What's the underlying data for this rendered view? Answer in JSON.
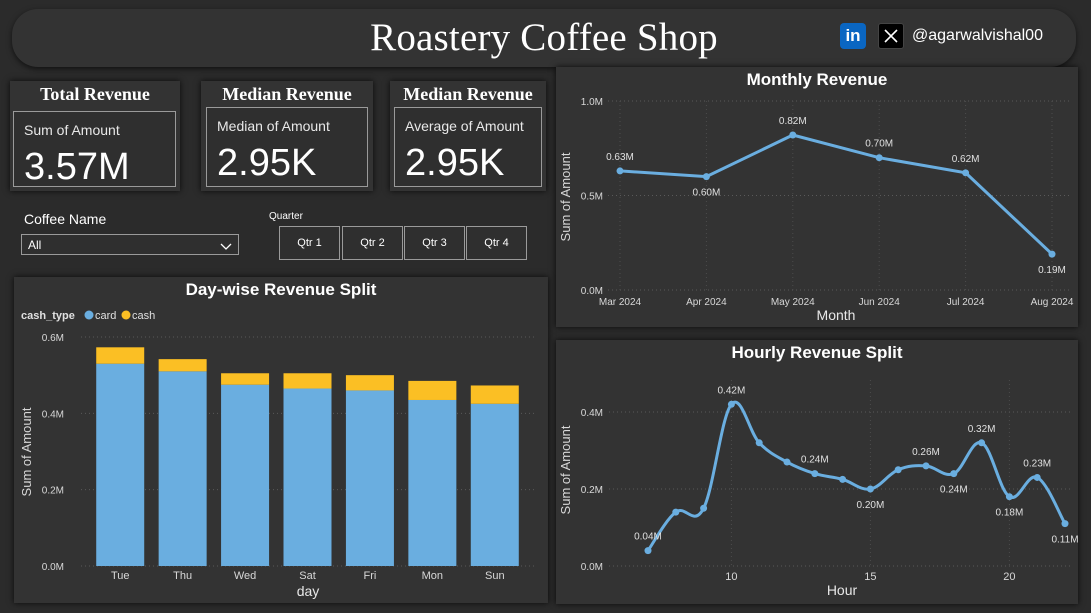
{
  "header": {
    "title": "Roastery Coffee Shop",
    "linkedin_icon_text": "in",
    "handle": "@agarwalvishal00"
  },
  "kpis": [
    {
      "title": "Total Revenue",
      "label": "Sum of Amount",
      "value": "3.57M"
    },
    {
      "title": "Median Revenue",
      "label": "Median of Amount",
      "value": "2.95K"
    },
    {
      "title": "Median Revenue",
      "label": "Average of Amount",
      "value": "2.95K"
    }
  ],
  "filters": {
    "coffee_name_label": "Coffee Name",
    "coffee_name_value": "All",
    "quarter_label": "Quarter",
    "quarters": [
      "Qtr 1",
      "Qtr 2",
      "Qtr 3",
      "Qtr 4"
    ]
  },
  "colors": {
    "card": "#6aaee0",
    "cash": "#fbbf24",
    "line": "#6aaee0",
    "background": "#2b2b2b",
    "panel": "#333333"
  },
  "chart_data": [
    {
      "type": "bar",
      "stacked": true,
      "title": "Day-wise Revenue Split",
      "legend_title": "cash_type",
      "legend_position": "top-left",
      "xlabel": "day",
      "ylabel": "Sum of Amount",
      "categories": [
        "Tue",
        "Thu",
        "Wed",
        "Sat",
        "Fri",
        "Mon",
        "Sun"
      ],
      "series": [
        {
          "name": "card",
          "values": [
            0.53,
            0.51,
            0.475,
            0.465,
            0.46,
            0.435,
            0.425
          ]
        },
        {
          "name": "cash",
          "values": [
            0.043,
            0.032,
            0.03,
            0.04,
            0.04,
            0.05,
            0.048
          ]
        }
      ],
      "ylim": [
        0,
        0.6
      ],
      "yticks": [
        "0.0M",
        "0.2M",
        "0.4M",
        "0.6M"
      ],
      "grid": true
    },
    {
      "type": "line",
      "title": "Monthly Revenue",
      "xlabel": "Month",
      "ylabel": "Sum of Amount",
      "categories": [
        "Mar 2024",
        "Apr 2024",
        "May 2024",
        "Jun 2024",
        "Jul 2024",
        "Aug 2024"
      ],
      "values": [
        0.63,
        0.6,
        0.82,
        0.7,
        0.62,
        0.19
      ],
      "data_labels": [
        "0.63M",
        "0.60M",
        "0.82M",
        "0.70M",
        "0.62M",
        "0.19M"
      ],
      "ylim": [
        0,
        1.0
      ],
      "yticks": [
        "0.0M",
        "0.5M",
        "1.0M"
      ],
      "grid": true
    },
    {
      "type": "line",
      "smooth": true,
      "title": "Hourly Revenue Split",
      "xlabel": "Hour",
      "ylabel": "Sum of Amount",
      "x": [
        7,
        8,
        9,
        10,
        11,
        12,
        13,
        14,
        15,
        16,
        17,
        18,
        19,
        20,
        21,
        22
      ],
      "values": [
        0.04,
        0.14,
        0.15,
        0.42,
        0.32,
        0.27,
        0.24,
        0.225,
        0.2,
        0.25,
        0.26,
        0.24,
        0.32,
        0.18,
        0.23,
        0.11
      ],
      "data_labels": {
        "7": "0.04M",
        "10": "0.42M",
        "13": "0.24M",
        "15": "0.20M",
        "17": "0.26M",
        "18": "0.24M",
        "19": "0.32M",
        "20": "0.18M",
        "21": "0.23M",
        "22": "0.11M"
      },
      "xticks": [
        "10",
        "15",
        "20"
      ],
      "ylim": [
        0,
        0.4
      ],
      "yticks": [
        "0.0M",
        "0.2M",
        "0.4M"
      ],
      "grid": true
    }
  ]
}
